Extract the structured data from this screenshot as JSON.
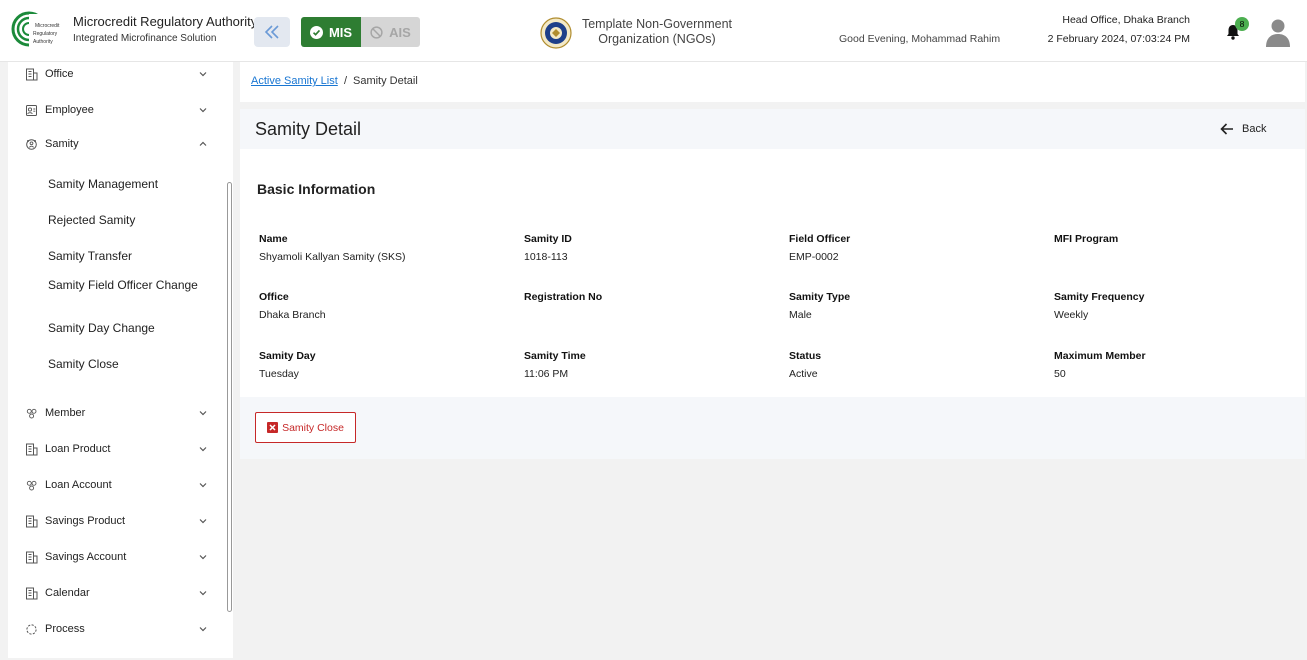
{
  "header": {
    "logo_text": "Microcredit Regulatory Authority",
    "brand_title": "Microcredit Regulatory Authority",
    "brand_subtitle": "Integrated Microfinance Solution",
    "mis_label": "MIS",
    "ais_label": "AIS",
    "org_name": "Template Non-Government Organization (NGOs)",
    "greeting": "Good Evening, Mohammad Rahim",
    "branch": "Head Office, Dhaka Branch",
    "datetime": "2 February 2024, 07:03:24 PM",
    "notification_count": "8"
  },
  "sidebar": {
    "items": [
      {
        "label": "Office",
        "icon": "building-icon",
        "expanded": false
      },
      {
        "label": "Employee",
        "icon": "employee-icon",
        "expanded": false
      },
      {
        "label": "Samity",
        "icon": "samity-icon",
        "expanded": true
      },
      {
        "label": "Member",
        "icon": "members-icon",
        "expanded": false
      },
      {
        "label": "Loan Product",
        "icon": "building-icon",
        "expanded": false
      },
      {
        "label": "Loan Account",
        "icon": "members-icon",
        "expanded": false
      },
      {
        "label": "Savings Product",
        "icon": "building-icon",
        "expanded": false
      },
      {
        "label": "Savings Account",
        "icon": "building-icon",
        "expanded": false
      },
      {
        "label": "Calendar",
        "icon": "building-icon",
        "expanded": false
      },
      {
        "label": "Process",
        "icon": "process-icon",
        "expanded": false
      }
    ],
    "samity_sub": [
      "Samity Management",
      "Rejected Samity",
      "Samity Transfer",
      "Samity Field Officer Change",
      "Samity Day Change",
      "Samity Close"
    ]
  },
  "breadcrumb": {
    "link": "Active Samity List",
    "separator": "/",
    "current": "Samity Detail"
  },
  "page": {
    "title": "Samity Detail",
    "back_label": "Back",
    "section_title": "Basic Information",
    "close_button": "Samity Close"
  },
  "fields": [
    {
      "label": "Name",
      "value": "Shyamoli Kallyan Samity (SKS)"
    },
    {
      "label": "Samity ID",
      "value": "1018-113"
    },
    {
      "label": "Field Officer",
      "value": "EMP-0002"
    },
    {
      "label": "MFI Program",
      "value": ""
    },
    {
      "label": "Office",
      "value": "Dhaka Branch"
    },
    {
      "label": "Registration No",
      "value": ""
    },
    {
      "label": "Samity Type",
      "value": "Male"
    },
    {
      "label": "Samity Frequency",
      "value": "Weekly"
    },
    {
      "label": "Samity Day",
      "value": "Tuesday"
    },
    {
      "label": "Samity Time",
      "value": "11:06 PM"
    },
    {
      "label": "Status",
      "value": "Active"
    },
    {
      "label": "Maximum Member",
      "value": "50"
    }
  ],
  "colors": {
    "accent_green": "#2e7d32",
    "danger": "#c62828",
    "link": "#1976d2"
  }
}
